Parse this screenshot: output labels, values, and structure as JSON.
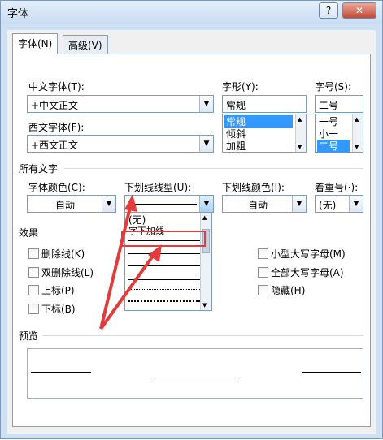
{
  "window": {
    "title": "字体",
    "help_label": "?",
    "close_label": "✕"
  },
  "tabs": [
    {
      "label": "字体(N)"
    },
    {
      "label": "高级(V)"
    }
  ],
  "labels": {
    "cn_font": "中文字体(T):",
    "west_font": "西文字体(F):",
    "style": "字形(Y):",
    "size": "字号(S):",
    "all_text": "所有文字",
    "font_color": "字体颜色(C):",
    "underline_type": "下划线线型(U):",
    "underline_color": "下划线颜色(I):",
    "emphasis": "着重号(·):",
    "effects": "效果",
    "preview": "预览"
  },
  "fields": {
    "cn_font": "+中文正文",
    "west_font": "+西文正文",
    "style_value": "常规",
    "size_value": "二号",
    "font_color": "自动",
    "underline_color": "自动",
    "emphasis": "(无)"
  },
  "style_list": [
    "常规",
    "倾斜",
    "加粗"
  ],
  "size_list": [
    "一号",
    "小一",
    "二号"
  ],
  "underline_popup": {
    "items": [
      "(无)",
      "字下加线"
    ]
  },
  "effects": [
    "删除线(K)",
    "双删除线(L)",
    "上标(P)",
    "下标(B)",
    "小型大写字母(M)",
    "全部大写字母(A)",
    "隐藏(H)"
  ],
  "colors": {
    "accent": "#3399ff",
    "highlight": "#e23c3c"
  }
}
